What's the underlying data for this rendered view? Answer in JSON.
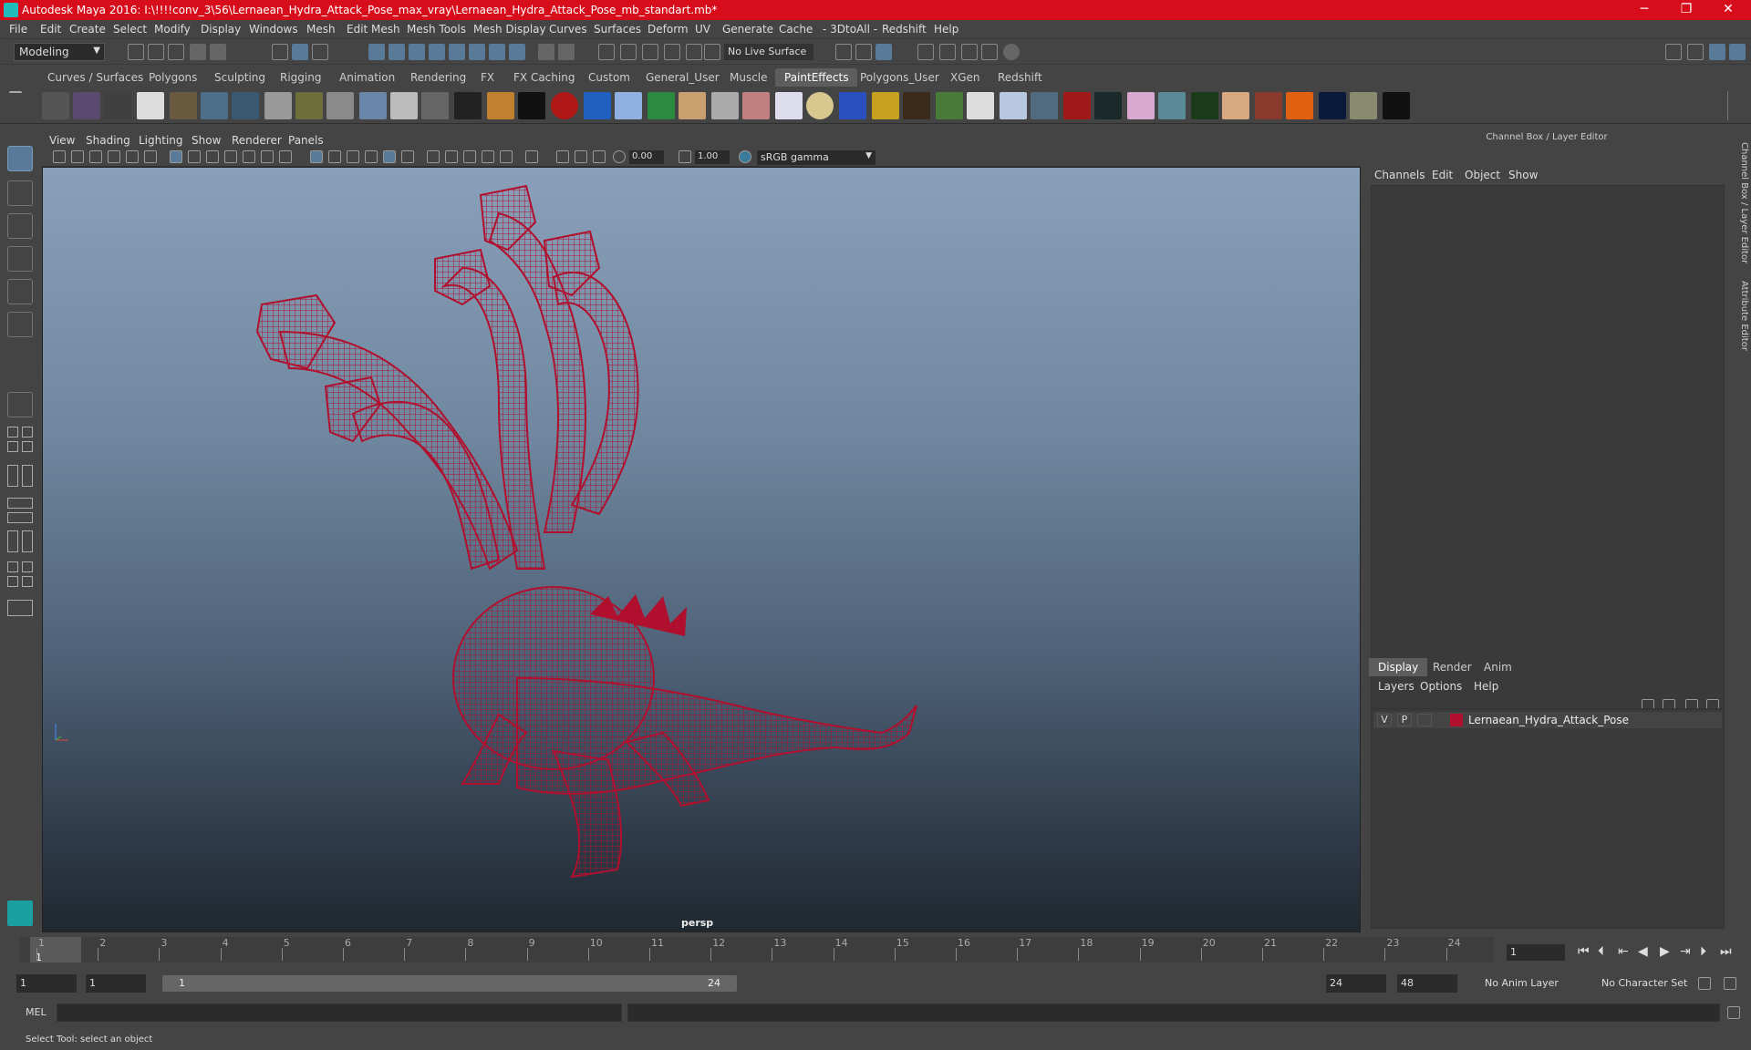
{
  "window": {
    "title": "Autodesk Maya 2016: I:\\!!!!conv_3\\56\\Lernaean_Hydra_Attack_Pose_max_vray\\Lernaean_Hydra_Attack_Pose_mb_standart.mb*",
    "minimize": "─",
    "maximize": "❐",
    "close": "✕"
  },
  "menubar": [
    "File",
    "Edit",
    "Create",
    "Select",
    "Modify",
    "Display",
    "Windows",
    "Mesh",
    "Edit Mesh",
    "Mesh Tools",
    "Mesh Display",
    "Curves",
    "Surfaces",
    "Deform",
    "UV",
    "Generate",
    "Cache",
    "- 3DtoAll -",
    "Redshift",
    "Help"
  ],
  "statusline": {
    "mode": "Modeling",
    "live_surface": "No Live Surface"
  },
  "shelf": {
    "tabs": [
      "Curves / Surfaces",
      "Polygons",
      "Sculpting",
      "Rigging",
      "Animation",
      "Rendering",
      "FX",
      "FX Caching",
      "Custom",
      "General_User",
      "Muscle",
      "PaintEffects",
      "Polygons_User",
      "XGen",
      "Redshift"
    ],
    "active_tab": "PaintEffects"
  },
  "viewport": {
    "menu": [
      "View",
      "Shading",
      "Lighting",
      "Show",
      "Renderer",
      "Panels"
    ],
    "exposure": "0.00",
    "gamma": "1.00",
    "color_space": "sRGB gamma",
    "camera": "persp",
    "wire_color": "#b0102e"
  },
  "right_panel": {
    "title": "Channel Box / Layer Editor",
    "menu": [
      "Channels",
      "Edit",
      "Object",
      "Show"
    ],
    "layer_tabs": [
      "Display",
      "Render",
      "Anim"
    ],
    "active_layer_tab": "Display",
    "layer_menu": [
      "Layers",
      "Options",
      "Help"
    ],
    "layer": {
      "v": "V",
      "p": "P",
      "name": "Lernaean_Hydra_Attack_Pose",
      "color": "#b0102e"
    },
    "side_tabs": [
      "Channel Box / Layer Editor",
      "Attribute Editor"
    ]
  },
  "timeline": {
    "ticks": [
      "1",
      "2",
      "3",
      "4",
      "5",
      "6",
      "7",
      "8",
      "9",
      "10",
      "11",
      "12",
      "13",
      "14",
      "15",
      "16",
      "17",
      "18",
      "19",
      "20",
      "21",
      "22",
      "23",
      "24"
    ],
    "current_frame": "1",
    "current_field": "1"
  },
  "range": {
    "start": "1",
    "playback_start": "1",
    "slider_start": "1",
    "slider_end": "24",
    "playback_end": "24",
    "end": "48",
    "anim_layer": "No Anim Layer",
    "character_set": "No Character Set"
  },
  "cmdline": {
    "label": "MEL"
  },
  "help": {
    "text": "Select Tool: select an object"
  }
}
